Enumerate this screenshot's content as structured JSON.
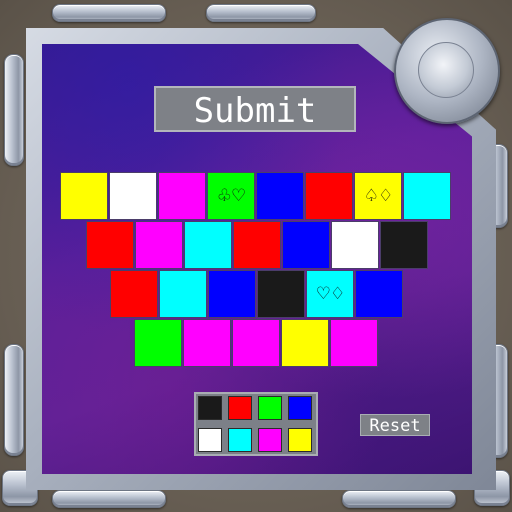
{
  "submit_label": "Submit",
  "reset_label": "Reset",
  "tile_rows": [
    [
      {
        "color": "#ffff00",
        "symbols": ""
      },
      {
        "color": "#ffffff",
        "symbols": ""
      },
      {
        "color": "#ff00ff",
        "symbols": ""
      },
      {
        "color": "#00ff00",
        "symbols": "♧♡"
      },
      {
        "color": "#0000ff",
        "symbols": ""
      },
      {
        "color": "#ff0000",
        "symbols": ""
      },
      {
        "color": "#ffff00",
        "symbols": "♤♢"
      },
      {
        "color": "#00ffff",
        "symbols": ""
      }
    ],
    [
      {
        "color": "#ff0000",
        "symbols": ""
      },
      {
        "color": "#ff00ff",
        "symbols": ""
      },
      {
        "color": "#00ffff",
        "symbols": ""
      },
      {
        "color": "#ff0000",
        "symbols": ""
      },
      {
        "color": "#0000ff",
        "symbols": ""
      },
      {
        "color": "#ffffff",
        "symbols": ""
      },
      {
        "color": "#1a1a1a",
        "symbols": ""
      }
    ],
    [
      {
        "color": "#ff0000",
        "symbols": ""
      },
      {
        "color": "#00ffff",
        "symbols": ""
      },
      {
        "color": "#0000ff",
        "symbols": ""
      },
      {
        "color": "#1a1a1a",
        "symbols": ""
      },
      {
        "color": "#00ffff",
        "symbols": "♡♢"
      },
      {
        "color": "#0000ff",
        "symbols": ""
      }
    ],
    [
      {
        "color": "#00ff00",
        "symbols": ""
      },
      {
        "color": "#ff00ff",
        "symbols": ""
      },
      {
        "color": "#ff00ff",
        "symbols": ""
      },
      {
        "color": "#ffff00",
        "symbols": ""
      },
      {
        "color": "#ff00ff",
        "symbols": ""
      }
    ]
  ],
  "palette": [
    [
      "#1a1a1a",
      "#ff0000",
      "#00ff00",
      "#0000ff"
    ],
    [
      "#ffffff",
      "#00ffff",
      "#ff00ff",
      "#ffff00"
    ]
  ]
}
